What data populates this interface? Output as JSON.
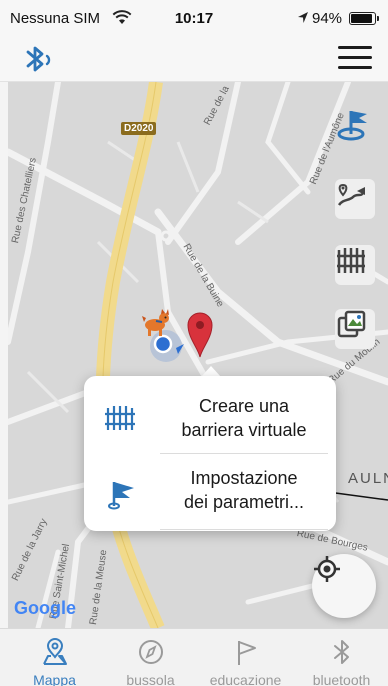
{
  "status_bar": {
    "carrier": "Nessuna SIM",
    "time": "10:17",
    "battery_percent": "94%",
    "battery_level": 0.94
  },
  "header": {
    "bluetooth_icon": "bluetooth-signal-icon",
    "menu_icon": "hamburger-menu-icon"
  },
  "map": {
    "streets": [
      "Rue des Chatelliers",
      "Rue de la Jarry",
      "Rue Saint-Michel",
      "Rue de la Meuse",
      "Rue de la Jarry",
      "Rue de l'Aumône",
      "Rue de la Buine",
      "Rue du Moulin",
      "Rue de Bourges",
      "Rue de la"
    ],
    "road_badge": "D2020",
    "place_label": "AULN",
    "map_attribution": "Google"
  },
  "popup": {
    "item1_line1": "Creare una",
    "item1_line2": "barriera virtuale",
    "item2_line1": "Impostazione",
    "item2_line2": "dei parametri..."
  },
  "tabs": [
    {
      "label": "Mappa",
      "active": true
    },
    {
      "label": "bussola",
      "active": false
    },
    {
      "label": "educazione",
      "active": false
    },
    {
      "label": "bluetooth",
      "active": false
    }
  ],
  "colors": {
    "accent_blue": "#3a7fbf",
    "road_yellow": "#f1da8c",
    "pin_red": "#d8323c"
  }
}
